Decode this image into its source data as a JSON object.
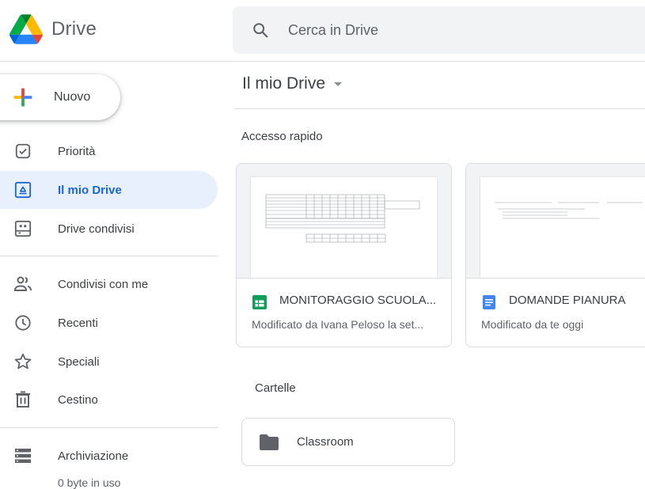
{
  "app": {
    "name": "Drive"
  },
  "search": {
    "placeholder": "Cerca in Drive"
  },
  "sidebar": {
    "new_label": "Nuovo",
    "items": [
      {
        "label": "Priorità",
        "icon": "priority-icon",
        "active": false
      },
      {
        "label": "Il mio Drive",
        "icon": "my-drive-icon",
        "active": true
      },
      {
        "label": "Drive condivisi",
        "icon": "shared-drives-icon",
        "active": false
      },
      {
        "label": "Condivisi con me",
        "icon": "people-icon",
        "active": false
      },
      {
        "label": "Recenti",
        "icon": "clock-icon",
        "active": false
      },
      {
        "label": "Speciali",
        "icon": "star-icon",
        "active": false
      },
      {
        "label": "Cestino",
        "icon": "trash-icon",
        "active": false
      },
      {
        "label": "Archiviazione",
        "icon": "storage-icon",
        "active": false
      }
    ],
    "storage_usage": "0 byte in uso"
  },
  "main": {
    "title": "Il mio Drive",
    "quick_access_label": "Accesso rapido",
    "quick_access": [
      {
        "name": "MONITORAGGIO SCUOLA...",
        "meta": "Modificato da Ivana Peloso la set...",
        "type": "sheets",
        "color": "#0f9d58"
      },
      {
        "name": "DOMANDE PIANURA",
        "meta": "Modificato da te oggi",
        "type": "docs",
        "color": "#4285f4"
      }
    ],
    "folders_label": "Cartelle",
    "folders": [
      {
        "name": "Classroom"
      }
    ]
  },
  "colors": {
    "accent": "#1967d2",
    "active_bg": "#e8f0fe",
    "search_bg": "#f1f3f4"
  }
}
